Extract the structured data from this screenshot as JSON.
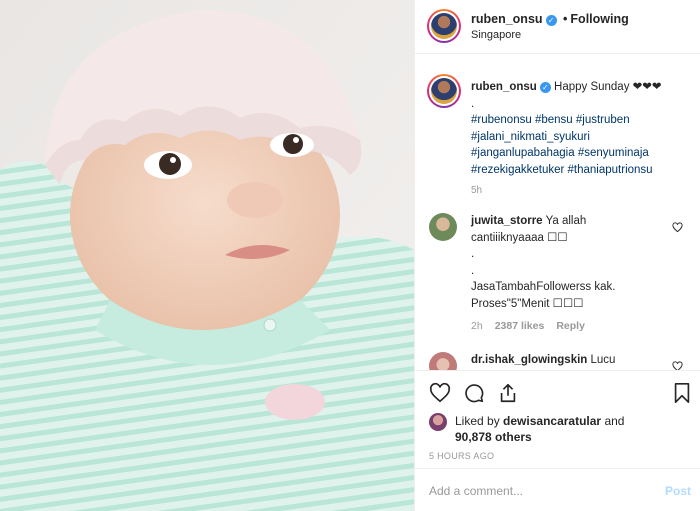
{
  "header": {
    "username": "ruben_onsu",
    "separator": "•",
    "follow_status": "Following",
    "location": "Singapore"
  },
  "caption": {
    "username": "ruben_onsu",
    "text": "Happy Sunday ❤❤❤",
    "dot_line": ".",
    "hashtags": [
      "#rubenonsu",
      "#bensu",
      "#justruben",
      "#jalani_nikmati_syukuri",
      "#janganlupabahagia",
      "#senyuminaja",
      "#rezekigakketuker",
      "#thaniaputrionsu"
    ],
    "time": "5h"
  },
  "comments": [
    {
      "username": "juwita_storre",
      "lines": [
        "Ya allah",
        "cantiiiknyaaaa ☐☐",
        ".",
        ".",
        "JasaTambahFollowerss kak.",
        "Proses\"5\"Menit ☐☐☐"
      ],
      "time": "2h",
      "likes": "2387 likes",
      "reply": "Reply"
    },
    {
      "username": "dr.ishak_glowingskin",
      "text": "Lucu"
    }
  ],
  "likes": {
    "prefix": "Liked by",
    "user": "dewisancaratular",
    "and": "and",
    "count": "90,878 others"
  },
  "posted_ago": "5 HOURS AGO",
  "add_comment": {
    "placeholder": "Add a comment...",
    "post_label": "Post"
  },
  "colors": {
    "verified_blue": "#3897f0",
    "hashtag": "#003569",
    "muted": "#999999",
    "post_disabled": "#b3dbff"
  },
  "icons": [
    "verified-badge-icon",
    "heart-icon",
    "comment-icon",
    "share-icon",
    "bookmark-icon",
    "small-heart-icon"
  ]
}
